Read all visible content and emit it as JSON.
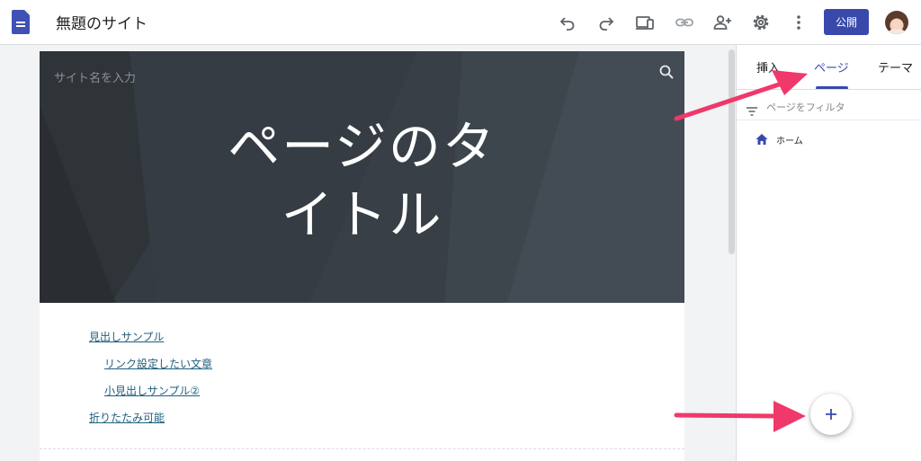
{
  "app": {
    "title": "無題のサイト",
    "icon": "google-sites-icon",
    "accent_color": "#3949ab"
  },
  "toolbar": {
    "icons": [
      "undo-icon",
      "redo-icon",
      "preview-devices-icon",
      "link-icon",
      "share-user-icon",
      "settings-gear-icon",
      "more-vert-icon"
    ],
    "publish_label": "公開",
    "avatar": "user-avatar"
  },
  "page": {
    "site_name_placeholder": "サイト名を入力",
    "hero_title_line1": "ページのタ",
    "hero_title_line2": "イトル",
    "hero_background_color": "#353b42",
    "toc": [
      {
        "label": "見出しサンプル",
        "level": 1
      },
      {
        "label": "リンク設定したい文章",
        "level": 2
      },
      {
        "label": "小見出しサンプル②",
        "level": 2
      },
      {
        "label": "折りたたみ可能",
        "level": 1
      }
    ]
  },
  "side_panel": {
    "tabs": [
      {
        "label": "挿入",
        "active": false
      },
      {
        "label": "ページ",
        "active": true
      },
      {
        "label": "テーマ",
        "active": false
      }
    ],
    "filter_placeholder": "ページをフィルタ",
    "pages": [
      {
        "label": "ホーム",
        "icon": "home-icon"
      }
    ],
    "add_button_icon": "plus-icon"
  },
  "annotations": {
    "arrow_color": "#f0386b"
  }
}
